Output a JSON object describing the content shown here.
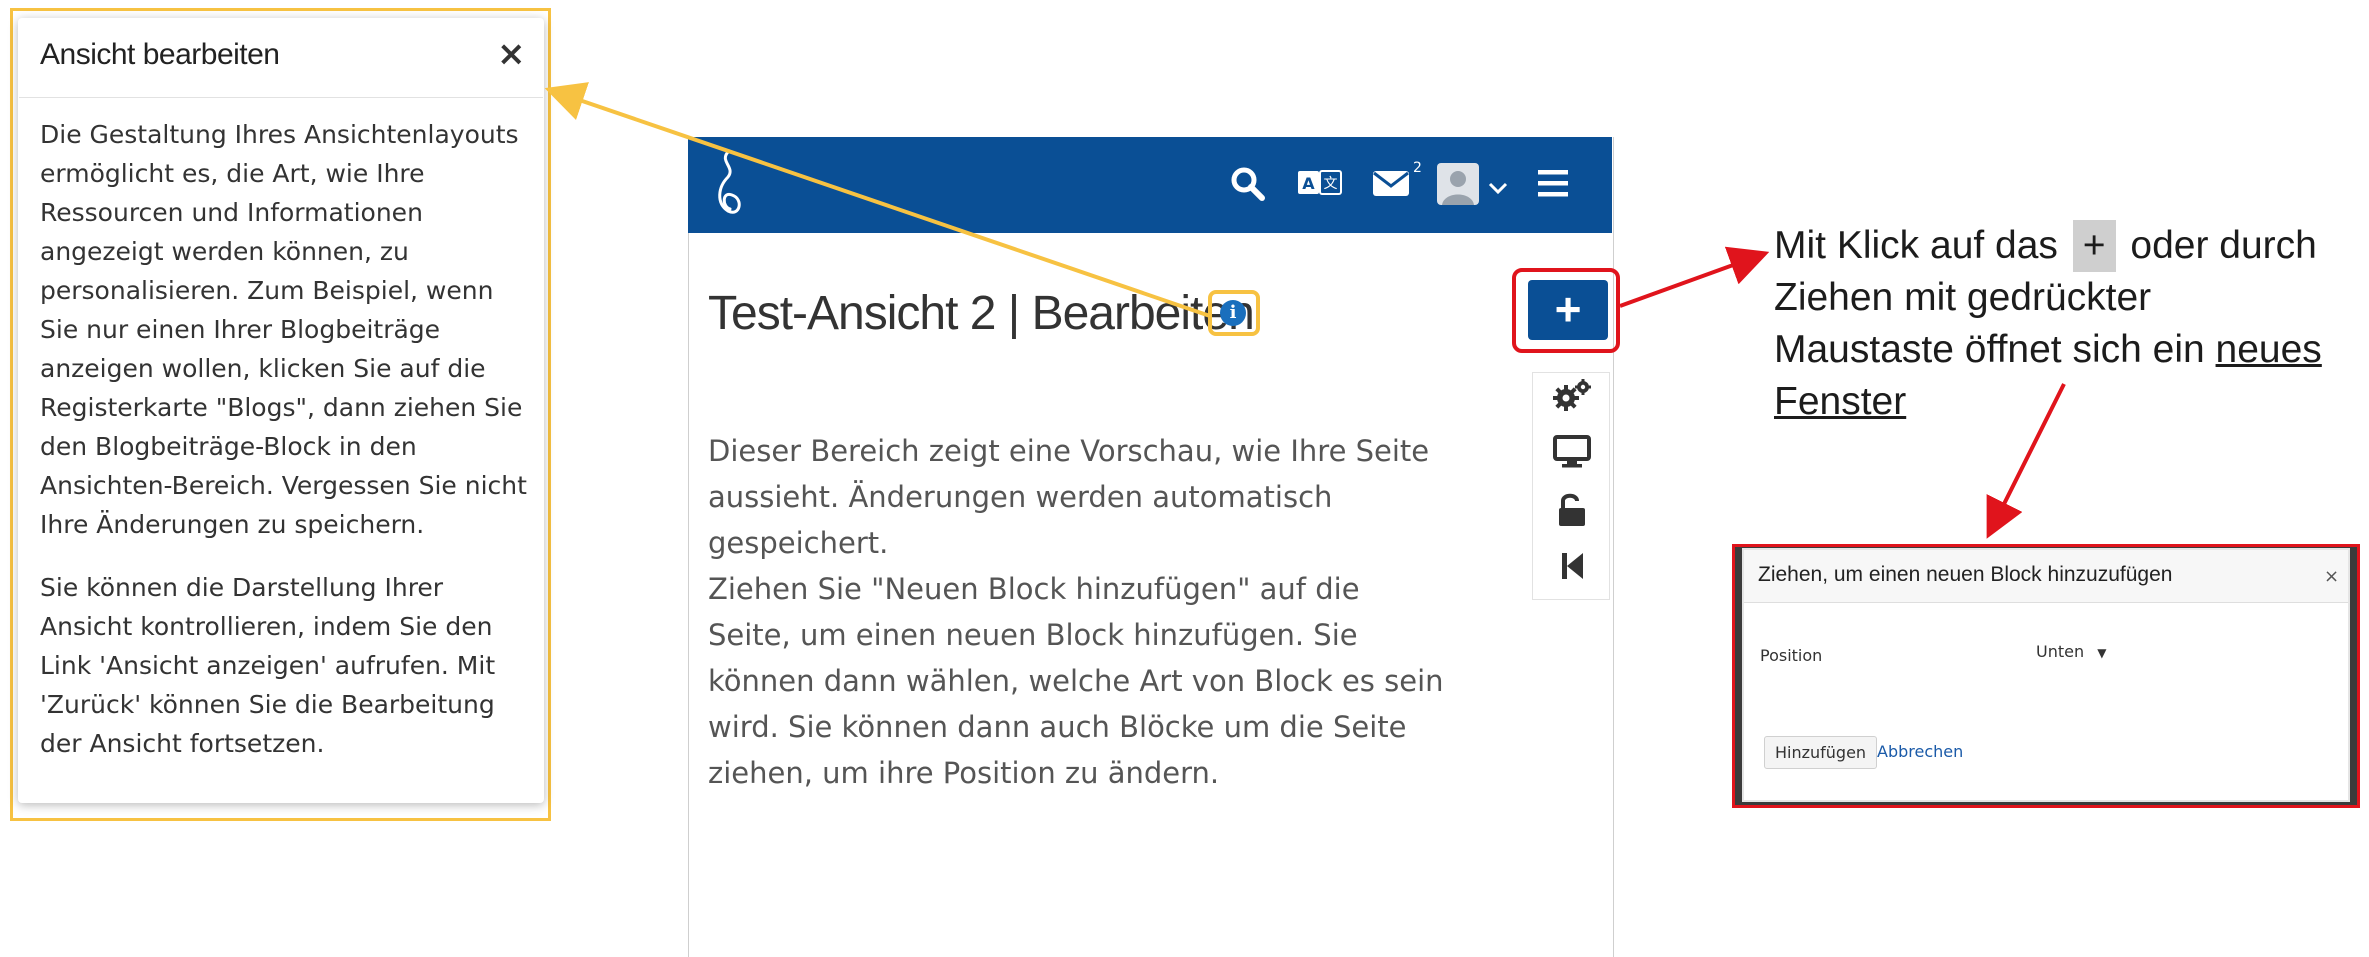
{
  "help": {
    "title": "Ansicht bearbeiten",
    "close": "×",
    "paragraph1": "Die Gestaltung Ihres Ansichtenlayouts ermöglicht es, die Art, wie Ihre Ressourcen und Informationen angezeigt werden können, zu personalisieren. Zum Beispiel, wenn Sie nur einen Ihrer Blogbeiträge anzeigen wollen, klicken Sie auf die Registerkarte \"Blogs\", dann ziehen Sie den Blogbeiträge-Block in den Ansichten-Bereich. Vergessen Sie nicht Ihre Änderungen zu speichern.",
    "paragraph2": "Sie können die Darstellung Ihrer Ansicht kontrollieren, indem Sie den Link 'Ansicht anzeigen' aufrufen. Mit 'Zurück' können Sie die Bearbeitung der Ansicht fortsetzen."
  },
  "navbar": {
    "icons": [
      "logo-icon",
      "search-icon",
      "language-icon",
      "mail-icon",
      "avatar-icon",
      "chevron-down-icon",
      "menu-icon"
    ],
    "mail_count": "2",
    "color": "#0a4f95"
  },
  "page": {
    "title": "Test-Ansicht 2 | Bearbeiten",
    "paragraph1": "Dieser Bereich zeigt eine Vorschau, wie Ihre Seite aussieht. Änderungen werden automatisch gespeichert.",
    "paragraph2": "Ziehen Sie \"Neuen Block hinzufügen\" auf die Seite, um einen neuen Block hinzufügen. Sie können dann wählen, welche Art von Block es sein wird. Sie können dann auch Blöcke um die Seite ziehen, um ihre Position zu ändern."
  },
  "toolbar": {
    "add": "+",
    "icons": [
      "settings-icon",
      "display-icon",
      "unlock-icon",
      "back-icon"
    ]
  },
  "annotation": {
    "pre": "Mit Klick auf das",
    "plus": "+",
    "post": "oder durch",
    "line2": "Ziehen mit gedrückter",
    "line3_pre": "Maustaste öffnet sich ein",
    "line3_link": "neues",
    "line4": "Fenster"
  },
  "dialog": {
    "title": "Ziehen, um einen neuen Block hinzuzufügen",
    "close": "×",
    "position_label": "Position",
    "position_value": "Unten",
    "add_button": "Hinzufügen",
    "cancel_link": "Abbrechen"
  },
  "colors": {
    "highlight_yellow": "#f7c242",
    "highlight_red": "#e0141c",
    "info_blue": "#1a6fbd"
  }
}
